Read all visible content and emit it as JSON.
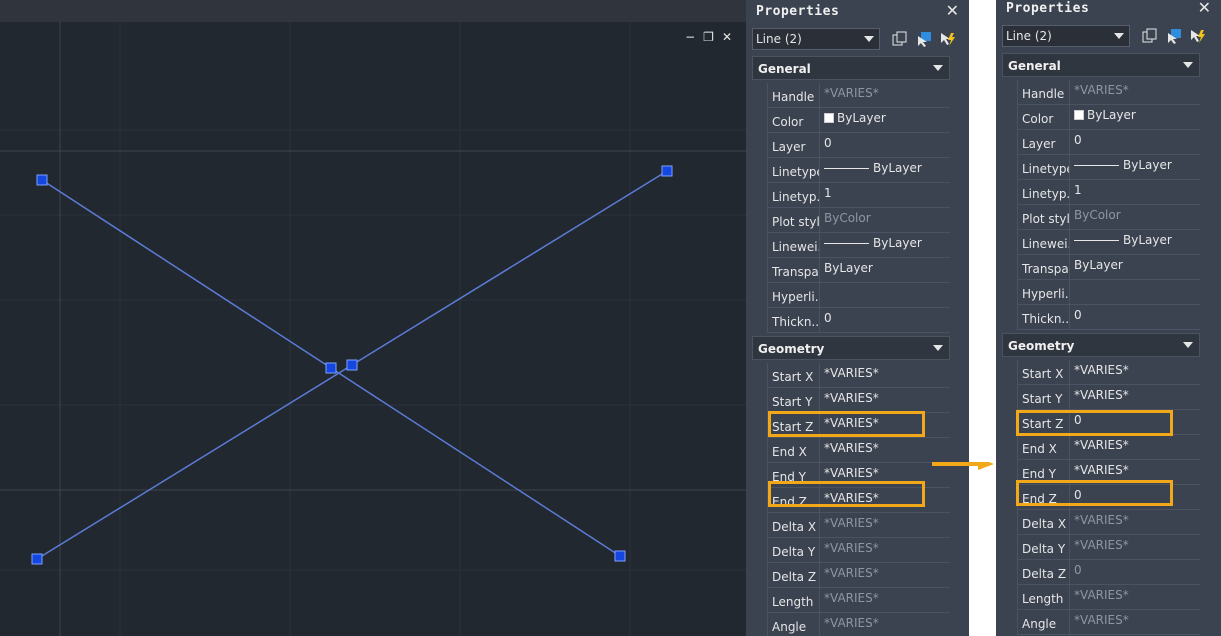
{
  "canvas": {
    "window_controls": [
      "−",
      "❐",
      "✕"
    ],
    "line_color": "#5b7bd5",
    "grip_color": "#1446e0"
  },
  "left_panel": {
    "title": "Properties",
    "close": "✕",
    "selection": "Line (2)",
    "general": {
      "header": "General",
      "rows": [
        {
          "label": "Handle",
          "value": "*VARIES*",
          "dim": true
        },
        {
          "label": "Color",
          "value": "ByLayer",
          "swatch": true
        },
        {
          "label": "Layer",
          "value": "0"
        },
        {
          "label": "Linetype",
          "value": "ByLayer",
          "linetype": true
        },
        {
          "label": "Linetyp...",
          "value": "1"
        },
        {
          "label": "Plot style",
          "value": "ByColor",
          "dim": true
        },
        {
          "label": "Linewei...",
          "value": "ByLayer",
          "linetype": true
        },
        {
          "label": "Transpa...",
          "value": "ByLayer"
        },
        {
          "label": "Hyperli...",
          "value": ""
        },
        {
          "label": "Thickn...",
          "value": "0"
        }
      ]
    },
    "geometry": {
      "header": "Geometry",
      "rows": [
        {
          "label": "Start X",
          "value": "*VARIES*"
        },
        {
          "label": "Start Y",
          "value": "*VARIES*"
        },
        {
          "label": "Start Z",
          "value": "*VARIES*"
        },
        {
          "label": "End X",
          "value": "*VARIES*"
        },
        {
          "label": "End Y",
          "value": "*VARIES*"
        },
        {
          "label": "End Z",
          "value": "*VARIES*"
        },
        {
          "label": "Delta X",
          "value": "*VARIES*",
          "dim": true
        },
        {
          "label": "Delta Y",
          "value": "*VARIES*",
          "dim": true
        },
        {
          "label": "Delta Z",
          "value": "*VARIES*",
          "dim": true
        },
        {
          "label": "Length",
          "value": "*VARIES*",
          "dim": true
        },
        {
          "label": "Angle",
          "value": "*VARIES*",
          "dim": true
        }
      ]
    }
  },
  "right_panel": {
    "title": "Properties",
    "close": "✕",
    "selection": "Line (2)",
    "general": {
      "header": "General",
      "rows": [
        {
          "label": "Handle",
          "value": "*VARIES*",
          "dim": true
        },
        {
          "label": "Color",
          "value": "ByLayer",
          "swatch": true
        },
        {
          "label": "Layer",
          "value": "0"
        },
        {
          "label": "Linetype",
          "value": "ByLayer",
          "linetype": true
        },
        {
          "label": "Linetyp...",
          "value": "1"
        },
        {
          "label": "Plot style",
          "value": "ByColor",
          "dim": true
        },
        {
          "label": "Linewei...",
          "value": "ByLayer",
          "linetype": true
        },
        {
          "label": "Transpa...",
          "value": "ByLayer"
        },
        {
          "label": "Hyperli...",
          "value": ""
        },
        {
          "label": "Thickn...",
          "value": "0"
        }
      ]
    },
    "geometry": {
      "header": "Geometry",
      "rows": [
        {
          "label": "Start X",
          "value": "*VARIES*"
        },
        {
          "label": "Start Y",
          "value": "*VARIES*"
        },
        {
          "label": "Start Z",
          "value": "0"
        },
        {
          "label": "End X",
          "value": "*VARIES*"
        },
        {
          "label": "End Y",
          "value": "*VARIES*"
        },
        {
          "label": "End Z",
          "value": "0"
        },
        {
          "label": "Delta X",
          "value": "*VARIES*",
          "dim": true
        },
        {
          "label": "Delta Y",
          "value": "*VARIES*",
          "dim": true
        },
        {
          "label": "Delta Z",
          "value": "0",
          "dim": true
        },
        {
          "label": "Length",
          "value": "*VARIES*",
          "dim": true
        },
        {
          "label": "Angle",
          "value": "*VARIES*",
          "dim": true
        }
      ]
    }
  },
  "annotation": {
    "highlight_color": "#f2a818"
  }
}
